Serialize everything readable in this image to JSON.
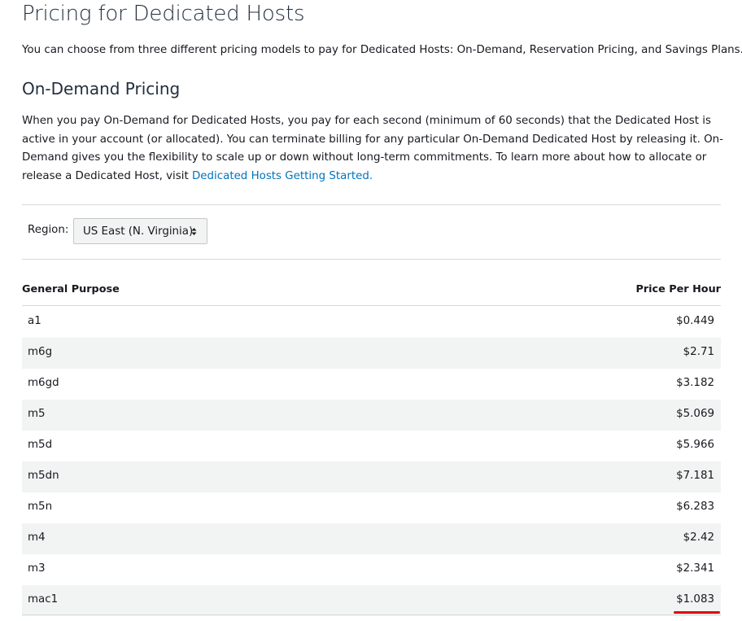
{
  "page": {
    "title": "Pricing for Dedicated Hosts",
    "intro": "You can choose from three different pricing models to pay for Dedicated Hosts: On-Demand, Reservation Pricing, and Savings Plans."
  },
  "on_demand": {
    "heading": "On-Demand Pricing",
    "description": "When you pay On-Demand for Dedicated Hosts, you pay for each second (minimum of 60 seconds) that the Dedicated Host is active in your account (or allocated). You can terminate billing for any particular On-Demand Dedicated Host by releasing it. On-Demand gives you the flexibility to scale up or down without long-term commitments. To learn more about how to allocate or release a Dedicated Host, visit ",
    "link_text": "Dedicated Hosts Getting Started."
  },
  "region": {
    "label": "Region:",
    "selected": "US East (N. Virginia)"
  },
  "table": {
    "columns": [
      "General Purpose",
      "Price Per Hour"
    ],
    "rows": [
      {
        "name": "a1",
        "price": "$0.449"
      },
      {
        "name": "m6g",
        "price": "$2.71"
      },
      {
        "name": "m6gd",
        "price": "$3.182"
      },
      {
        "name": "m5",
        "price": "$5.069"
      },
      {
        "name": "m5d",
        "price": "$5.966"
      },
      {
        "name": "m5dn",
        "price": "$7.181"
      },
      {
        "name": "m5n",
        "price": "$6.283"
      },
      {
        "name": "m4",
        "price": "$2.42"
      },
      {
        "name": "m3",
        "price": "$2.341"
      },
      {
        "name": "mac1",
        "price": "$1.083"
      }
    ]
  },
  "colors": {
    "link": "#0073bb",
    "highlight_annotation": "#e00000",
    "alt_row": "#f2f3f3"
  },
  "icons": {
    "select_caret": "sort-caret-icon"
  }
}
